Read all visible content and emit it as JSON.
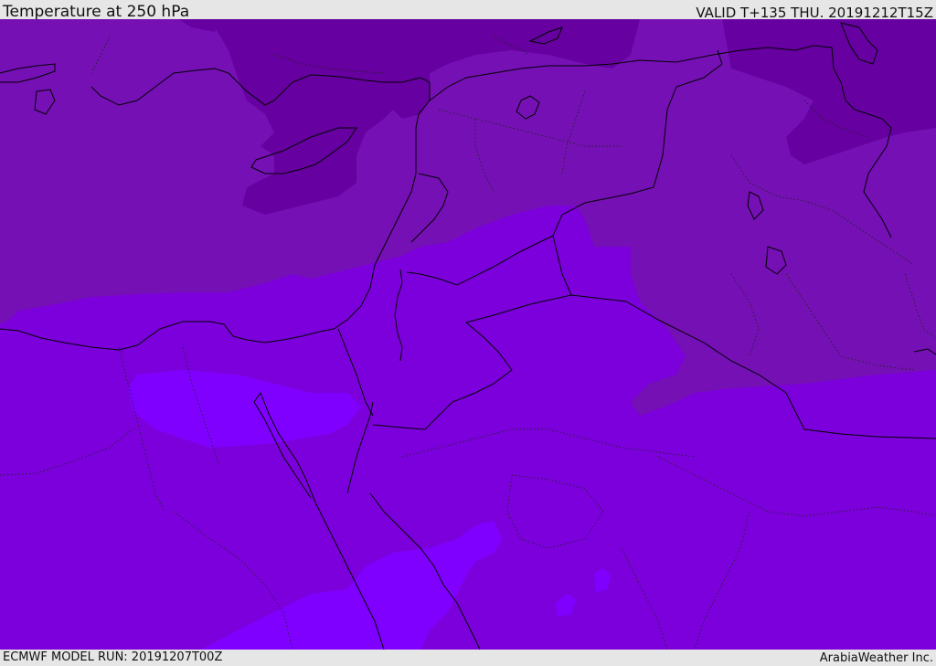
{
  "header": {
    "title": "Temperature at 250 hPa",
    "valid": "VALID T+135 THU. 20191212T15Z"
  },
  "footer": {
    "model_run": "ECMWF MODEL RUN: 20191207T00Z",
    "credit": "ArabiaWeather Inc."
  },
  "colors": {
    "header_bg": "#e6e6e6",
    "band_coldest": "#6600a0",
    "band_cold": "#7510b4",
    "band_mid": "#7c00dc",
    "band_warm": "#8000ff",
    "coastline": "#000000"
  },
  "map": {
    "projection": "regional Middle East / Eastern Mediterranean",
    "field": "temperature shading",
    "overlays": [
      "coastlines",
      "country-borders",
      "province-borders"
    ]
  }
}
